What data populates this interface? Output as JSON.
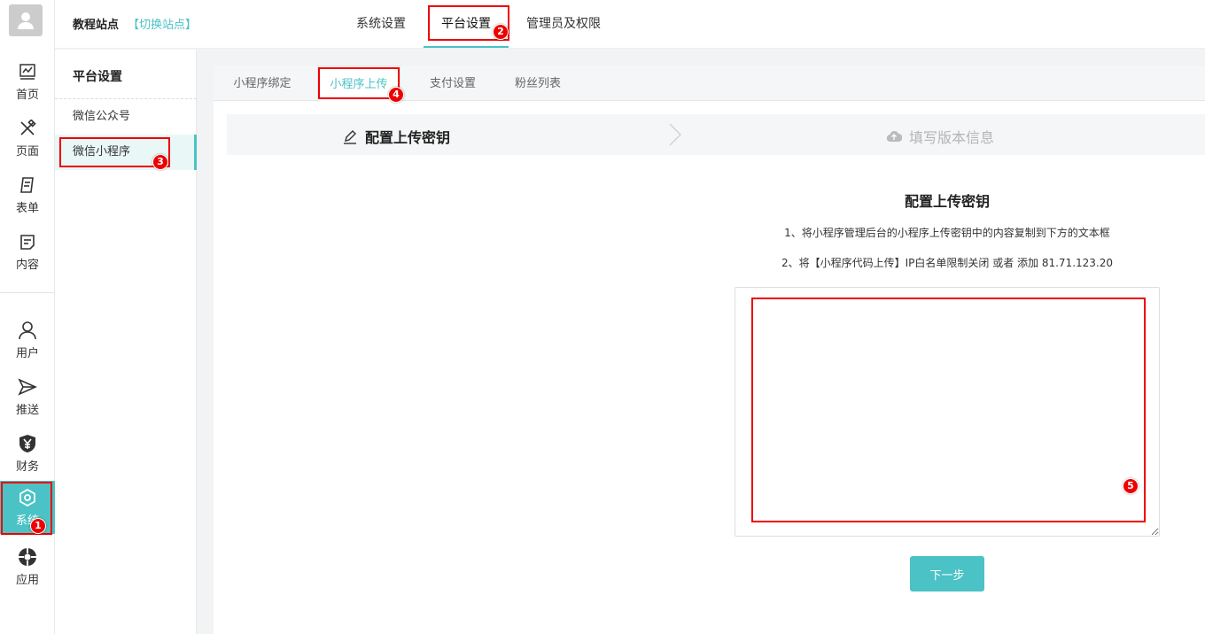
{
  "header": {
    "site_name": "教程站点",
    "switch_site": "【切换站点】",
    "nav": [
      {
        "label": "系统设置"
      },
      {
        "label": "平台设置"
      },
      {
        "label": "管理员及权限"
      }
    ]
  },
  "rail": {
    "items": [
      {
        "label": "首页",
        "icon": "chart-icon"
      },
      {
        "label": "页面",
        "icon": "design-icon"
      },
      {
        "label": "表单",
        "icon": "form-icon"
      },
      {
        "label": "内容",
        "icon": "content-icon"
      },
      {
        "label": "用户",
        "icon": "user-icon"
      },
      {
        "label": "推送",
        "icon": "send-icon"
      },
      {
        "label": "财务",
        "icon": "yen-icon"
      },
      {
        "label": "系统",
        "icon": "settings-icon"
      },
      {
        "label": "应用",
        "icon": "apps-icon"
      }
    ],
    "active": "系统"
  },
  "subnav": {
    "title": "平台设置",
    "items": [
      {
        "label": "微信公众号"
      },
      {
        "label": "微信小程序"
      }
    ],
    "active": "微信小程序"
  },
  "tabs": [
    {
      "label": "小程序绑定"
    },
    {
      "label": "小程序上传"
    },
    {
      "label": "支付设置"
    },
    {
      "label": "粉丝列表"
    }
  ],
  "steps": [
    {
      "label": "配置上传密钥",
      "icon": "pencil-icon",
      "state": "current"
    },
    {
      "label": "填写版本信息",
      "icon": "cloud-upload-icon",
      "state": "pending"
    }
  ],
  "config": {
    "title": "配置上传密钥",
    "instruction_1": "1、将小程序管理后台的小程序上传密钥中的内容复制到下方的文本框",
    "instruction_2": "2、将【小程序代码上传】IP白名单限制关闭 或者 添加 81.71.123.20",
    "textarea_value": "",
    "next_button": "下一步"
  },
  "annotations": {
    "badges": [
      "1",
      "2",
      "3",
      "4",
      "5"
    ],
    "color": "#e00000"
  },
  "colors": {
    "accent": "#4bc2c5",
    "annotation": "#e00000"
  }
}
